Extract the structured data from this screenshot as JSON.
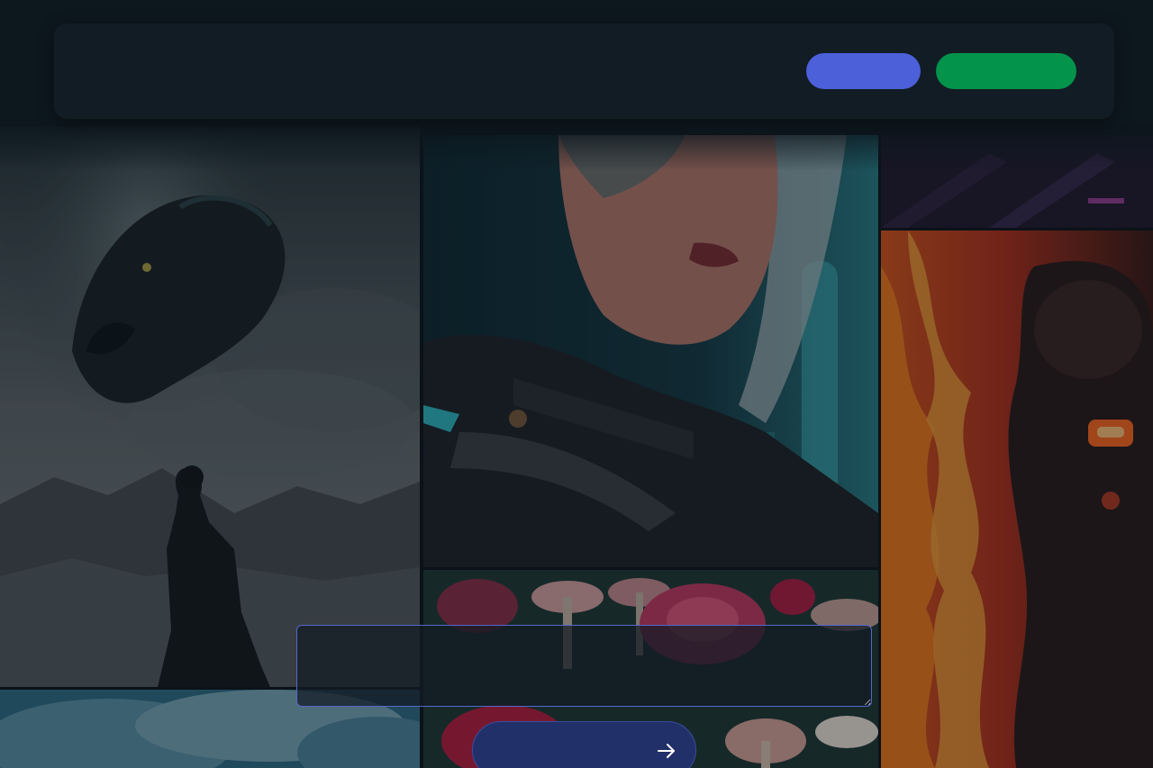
{
  "header": {
    "primary_button_label": "",
    "secondary_button_label": ""
  },
  "gallery": {
    "tiles": [
      {
        "name": "panther-warrior-image"
      },
      {
        "name": "blue-smoke-image"
      },
      {
        "name": "cyberpunk-woman-image"
      },
      {
        "name": "roses-mushrooms-image"
      },
      {
        "name": "neon-scene-image"
      },
      {
        "name": "fire-robot-image"
      }
    ]
  },
  "prompt": {
    "value": "",
    "placeholder": ""
  },
  "submit": {
    "label": "",
    "icon": "arrow-right-icon"
  },
  "colors": {
    "background": "#0d151c",
    "header": "#121c24",
    "primary_button": "#4b60d9",
    "secondary_button": "#03934b",
    "prompt_border": "#5568c9",
    "submit_button": "#22306a"
  }
}
